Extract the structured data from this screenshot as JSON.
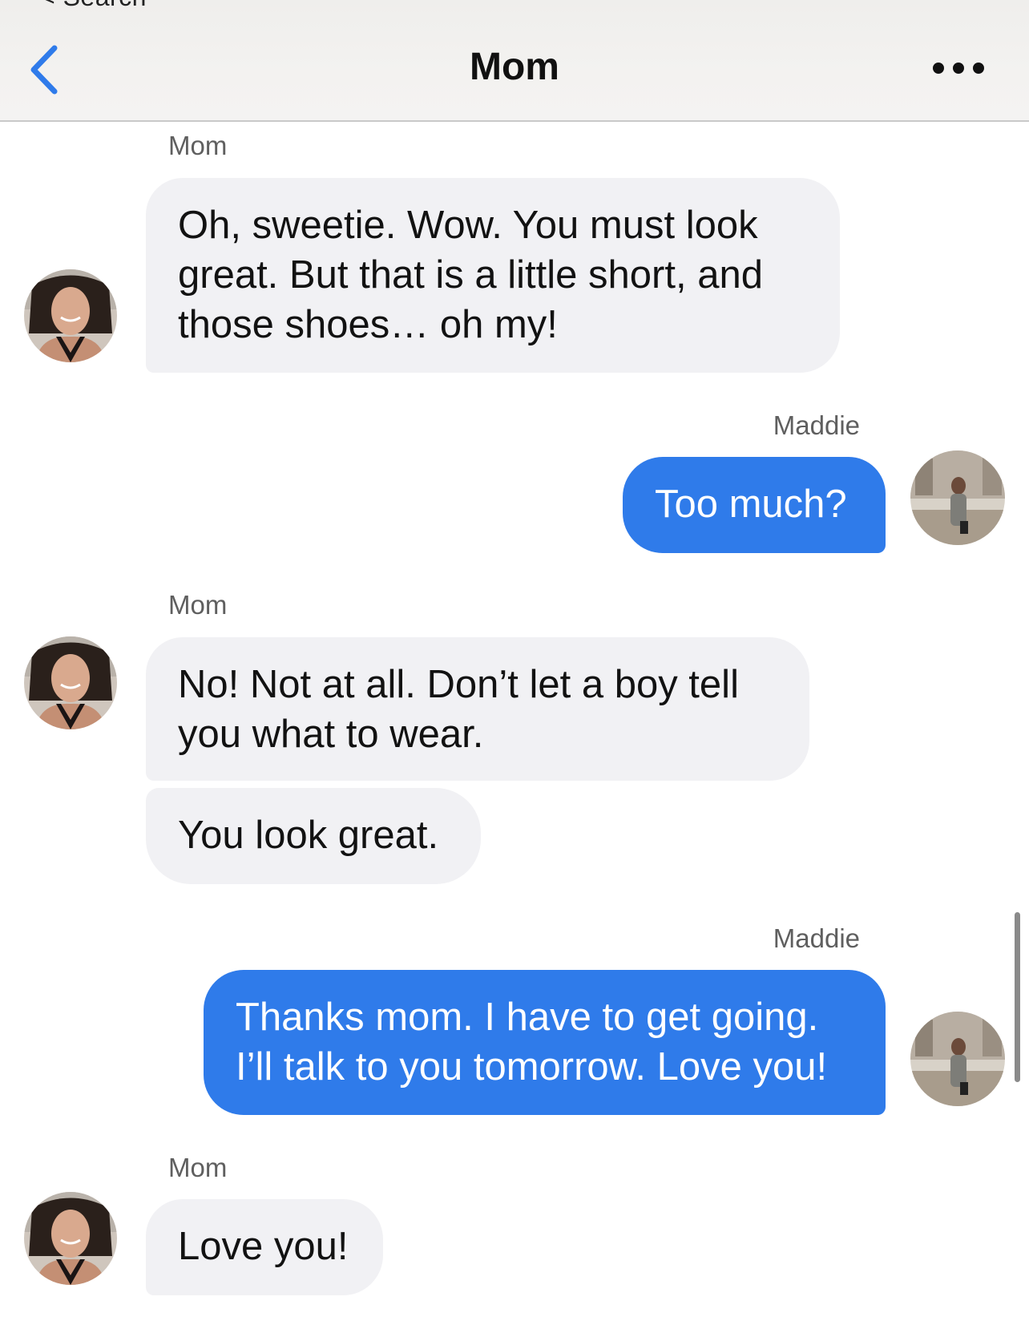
{
  "header": {
    "status_peek": "< Search",
    "title": "Mom",
    "back_icon": "chevron-left-icon",
    "more_icon": "ellipsis-icon"
  },
  "colors": {
    "accent": "#2f7bea",
    "incoming_bubble": "#f1f1f4",
    "header_bg": "#f2f1ef"
  },
  "messages": [
    {
      "sender": "Mom",
      "direction": "incoming",
      "bubbles": [
        {
          "line1": "Oh, sweetie. Wow. You must look",
          "line2": "great. But that is a little short, and",
          "line3": "those shoes… oh my!"
        }
      ]
    },
    {
      "sender": "Maddie",
      "direction": "outgoing",
      "bubbles": [
        {
          "line1": "Too much?"
        }
      ]
    },
    {
      "sender": "Mom",
      "direction": "incoming",
      "bubbles": [
        {
          "line1": "No! Not at all. Don’t let a boy tell",
          "line2": "you what to wear."
        },
        {
          "line1": "You look great."
        }
      ]
    },
    {
      "sender": "Maddie",
      "direction": "outgoing",
      "bubbles": [
        {
          "line1": "Thanks mom. I have to get going.",
          "line2": "I’ll talk to you tomorrow. Love you!"
        }
      ]
    },
    {
      "sender": "Mom",
      "direction": "incoming",
      "bubbles": [
        {
          "line1": "Love you!"
        }
      ]
    }
  ]
}
